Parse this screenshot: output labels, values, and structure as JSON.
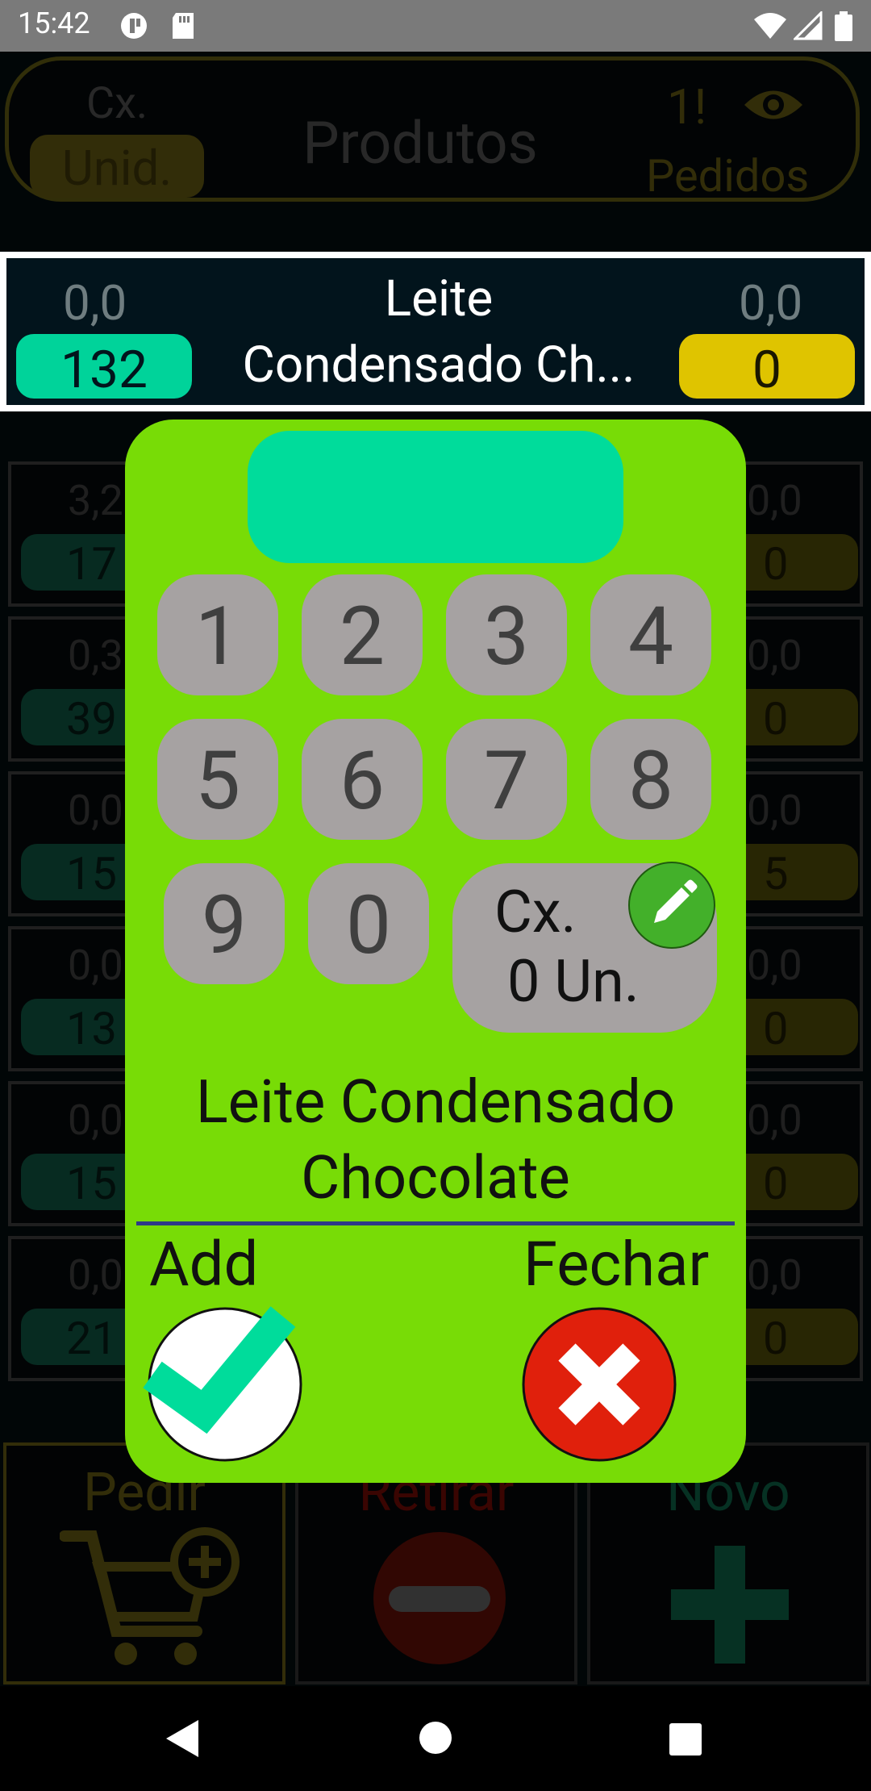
{
  "status_bar": {
    "time": "15:42"
  },
  "background": {
    "title": "Produtos",
    "mode_top": "Cx.",
    "mode_selected": "Unid.",
    "orders_count": "1!",
    "orders_label": "Pedidos",
    "rows": [
      {
        "left_value": "3,2",
        "left_badge": "17",
        "right_value": "0,0",
        "right_badge": "0"
      },
      {
        "left_value": "0,3",
        "left_badge": "39",
        "right_value": "0,0",
        "right_badge": "0"
      },
      {
        "left_value": "0,0",
        "left_badge": "15",
        "right_value": "0,0",
        "right_badge": "5"
      },
      {
        "left_value": "0,0",
        "left_badge": "13",
        "right_value": "0,0",
        "right_badge": "0"
      },
      {
        "left_value": "0,0",
        "left_badge": "15",
        "right_value": "0,0",
        "right_badge": "0"
      },
      {
        "left_value": "0,0",
        "left_badge": "21",
        "right_value": "0,0",
        "right_badge": "0"
      }
    ],
    "buttons": {
      "pedir": "Pedir",
      "retirar": "Retirar",
      "novo": "Novo"
    }
  },
  "product_header": {
    "left_value": "0,0",
    "left_badge": "132",
    "name_line1": "Leite",
    "name_line2": "Condensado Ch...",
    "right_value": "0,0",
    "right_badge": "0"
  },
  "dialog": {
    "display_value": "",
    "keys": [
      "1",
      "2",
      "3",
      "4",
      "5",
      "6",
      "7",
      "8",
      "9",
      "0"
    ],
    "unit_label": "Cx.",
    "unit_count": "0 Un.",
    "product_name": "Leite Condensado Chocolate",
    "add_label": "Add",
    "close_label": "Fechar"
  },
  "colors": {
    "dialog_bg": "#78dc06",
    "display_bg": "#00dc9b",
    "key_bg": "#a6a2a2",
    "green_badge": "#00d39a",
    "yellow_badge": "#dfc400",
    "close_red": "#e0200c"
  }
}
